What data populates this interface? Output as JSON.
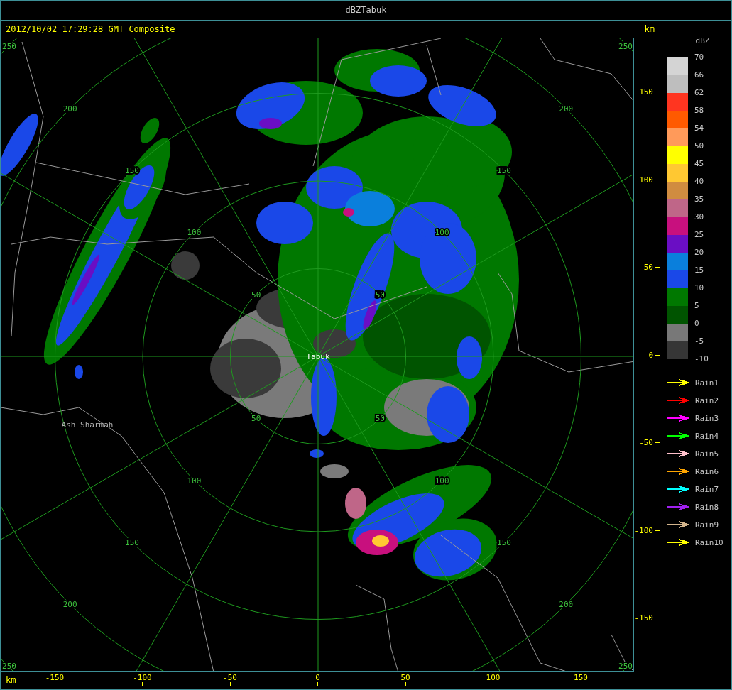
{
  "window": {
    "title": "dBZTabuk"
  },
  "header": {
    "timestamp": "2012/10/02 17:29:28 GMT Composite"
  },
  "map": {
    "range_rings": [
      {
        "labels": [
          "50",
          "50",
          "50",
          "50"
        ]
      },
      {
        "labels": [
          "100",
          "100",
          "100",
          "100"
        ]
      },
      {
        "labels": [
          "150",
          "150",
          "150",
          "150"
        ]
      },
      {
        "labels": [
          "200",
          "200",
          "200",
          "200"
        ]
      },
      {
        "labels": [
          "250",
          "250",
          "250",
          "250"
        ]
      }
    ],
    "places": [
      {
        "name": "Tabuk",
        "kind": "radar"
      },
      {
        "name": "Ash_Sharmah",
        "kind": "town"
      }
    ]
  },
  "y_axis": {
    "unit": "km",
    "ticks": [
      "150",
      "100",
      "50",
      "0",
      "-50",
      "-100",
      "-150"
    ]
  },
  "x_axis": {
    "unit": "km",
    "ticks": [
      "-150",
      "-100",
      "-50",
      "0",
      "50",
      "100",
      "150"
    ]
  },
  "legend": {
    "title": "dBZ",
    "bottom_label": "-10",
    "bins": [
      {
        "label": "70",
        "color": "#d4d4d4"
      },
      {
        "label": "66",
        "color": "#bebebe"
      },
      {
        "label": "62",
        "color": "#ff3520"
      },
      {
        "label": "58",
        "color": "#ff5a00"
      },
      {
        "label": "54",
        "color": "#ff9a5a"
      },
      {
        "label": "50",
        "color": "#ffff00"
      },
      {
        "label": "45",
        "color": "#ffc832"
      },
      {
        "label": "40",
        "color": "#d08c40"
      },
      {
        "label": "35",
        "color": "#bf6688"
      },
      {
        "label": "30",
        "color": "#c8107e"
      },
      {
        "label": "25",
        "color": "#6a0ec4"
      },
      {
        "label": "20",
        "color": "#0a7fdc"
      },
      {
        "label": "15",
        "color": "#1a48e8"
      },
      {
        "label": "10",
        "color": "#007800"
      },
      {
        "label": "5",
        "color": "#005400"
      },
      {
        "label": "0",
        "color": "#787878"
      },
      {
        "label": "-5",
        "color": "#363636"
      }
    ],
    "tracks": [
      {
        "label": "Rain1",
        "color": "#ffff00"
      },
      {
        "label": "Rain2",
        "color": "#ff0000"
      },
      {
        "label": "Rain3",
        "color": "#ff00ff"
      },
      {
        "label": "Rain4",
        "color": "#00ff00"
      },
      {
        "label": "Rain5",
        "color": "#ffc0cb"
      },
      {
        "label": "Rain6",
        "color": "#ffa500"
      },
      {
        "label": "Rain7",
        "color": "#00ffff"
      },
      {
        "label": "Rain8",
        "color": "#a020f0"
      },
      {
        "label": "Rain9",
        "color": "#d2b48c"
      },
      {
        "label": "Rain10",
        "color": "#ffff00"
      }
    ]
  }
}
